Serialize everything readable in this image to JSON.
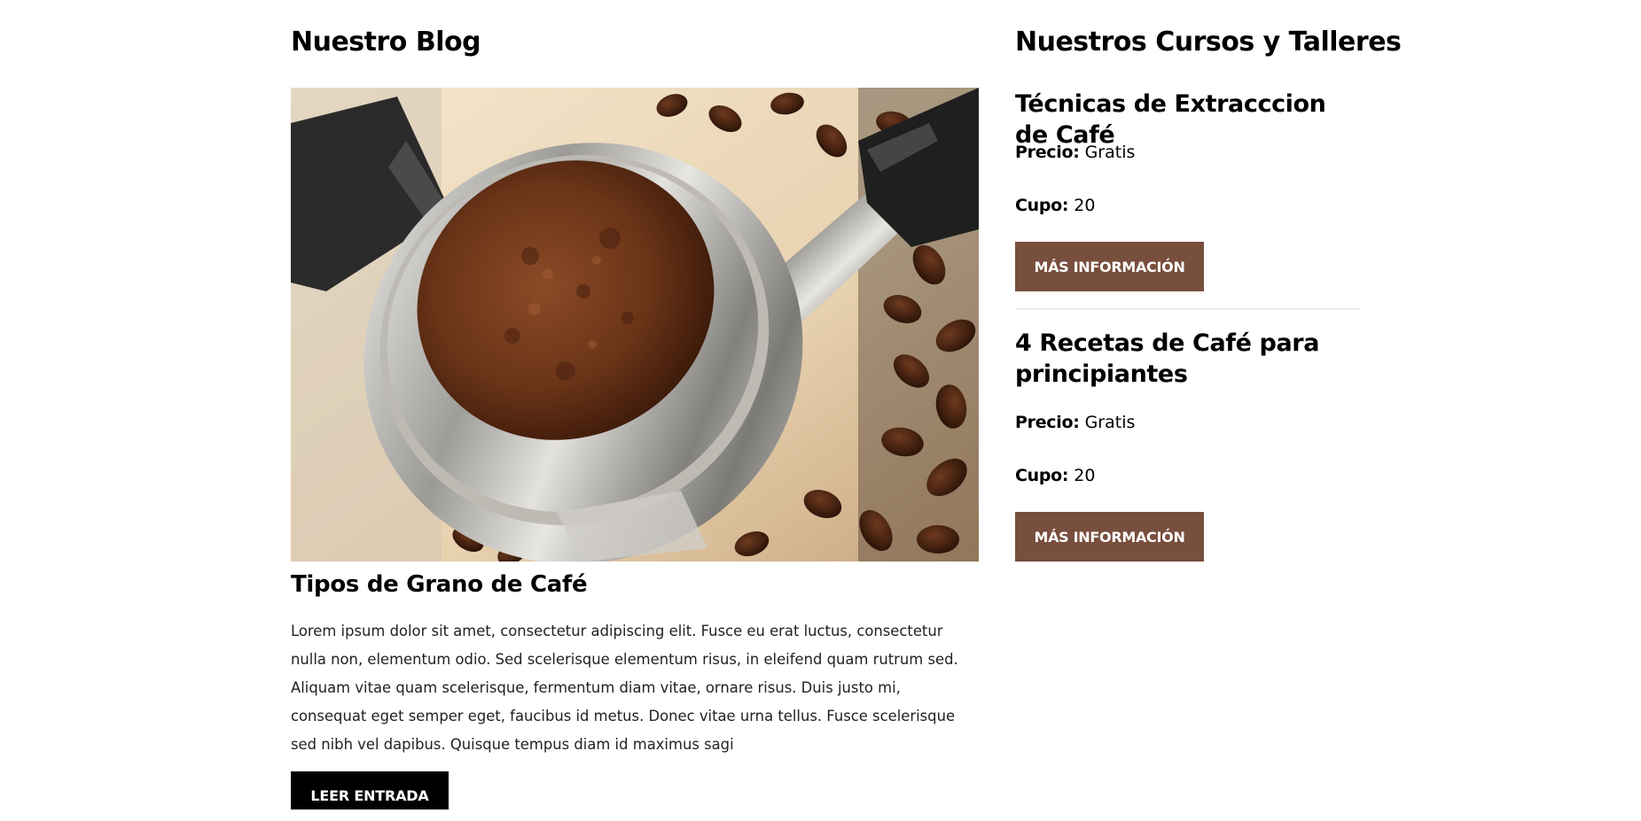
{
  "blog": {
    "heading": "Nuestro Blog",
    "post": {
      "image_alt": "portafiltro con café molido y granos de café",
      "title": "Tipos de Grano de Café",
      "body": "Lorem ipsum dolor sit amet, consectetur adipiscing elit. Fusce eu erat luctus, consectetur nulla non, elementum odio. Sed scelerisque elementum risus, in eleifend quam rutrum sed. Aliquam vitae quam scelerisque, fermentum diam vitae, ornare risus. Duis justo mi, consequat eget semper eget, faucibus id metus. Donec vitae urna tellus. Fusce scelerisque sed nibh vel dapibus. Quisque tempus diam id maximus sagi",
      "button_label": "LEER ENTRADA"
    }
  },
  "courses": {
    "heading": "Nuestros Cursos y Talleres",
    "items": [
      {
        "title": "Técnicas de Extracccion de Café",
        "price_label": "Precio:",
        "price_value": "Gratis",
        "capacity_label": "Cupo:",
        "capacity_value": "20",
        "button_label": "MÁS INFORMACIÓN"
      },
      {
        "title": "4 Recetas de Café para principiantes",
        "price_label": "Precio:",
        "price_value": "Gratis",
        "capacity_label": "Cupo:",
        "capacity_value": "20",
        "button_label": "MÁS INFORMACIÓN"
      }
    ]
  },
  "colors": {
    "accent_brown": "#784e3d",
    "button_dark": "#000000",
    "text": "#000000"
  }
}
